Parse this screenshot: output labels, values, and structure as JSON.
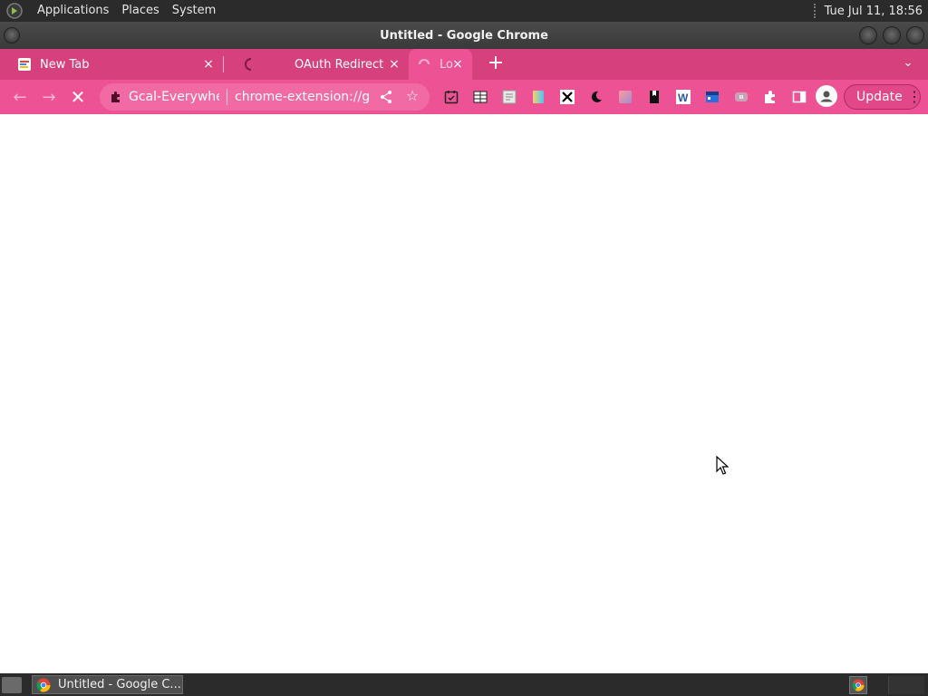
{
  "panel": {
    "menus": [
      "Applications",
      "Places",
      "System"
    ],
    "clock": "Tue Jul 11, 18:56"
  },
  "window": {
    "title": "Untitled - Google Chrome"
  },
  "tabs": [
    {
      "label": "New Tab",
      "favicon": "new-tab-colored-icon",
      "close": "×"
    },
    {
      "label": "OAuth Redirect",
      "favicon": "oauth-loading-icon",
      "close": "×"
    },
    {
      "label": "Lo",
      "favicon": "loading-spinner-icon",
      "close": "×"
    }
  ],
  "new_tab_symbol": "+",
  "tab_menu_symbol": "⌄",
  "toolbar": {
    "back_symbol": "←",
    "forward_symbol": "→",
    "stop_symbol": "✕",
    "site_label": "Gcal-Everywher",
    "url": "chrome-extension://g...",
    "bookmark_symbol": "☆",
    "update_label": "Update",
    "menu_symbol": "⋮"
  },
  "extensions": [
    "calendar-check-icon",
    "table-icon",
    "grid-doc-icon",
    "gradient-doc-icon",
    "x-logo-icon",
    "moon-icon",
    "photo-gradient-icon",
    "bookmark-book-icon",
    "word-w-icon",
    "calendar-blue-icon",
    "grey-badge-icon",
    "puzzle-extensions-icon",
    "side-panel-icon"
  ],
  "taskbar": {
    "task_title": "Untitled - Google C..."
  },
  "colors": {
    "tabstrip": "#d6407d",
    "toolbar": "#ec5294",
    "omnibox": "#f26aa4",
    "panel": "#2b2b2b"
  }
}
